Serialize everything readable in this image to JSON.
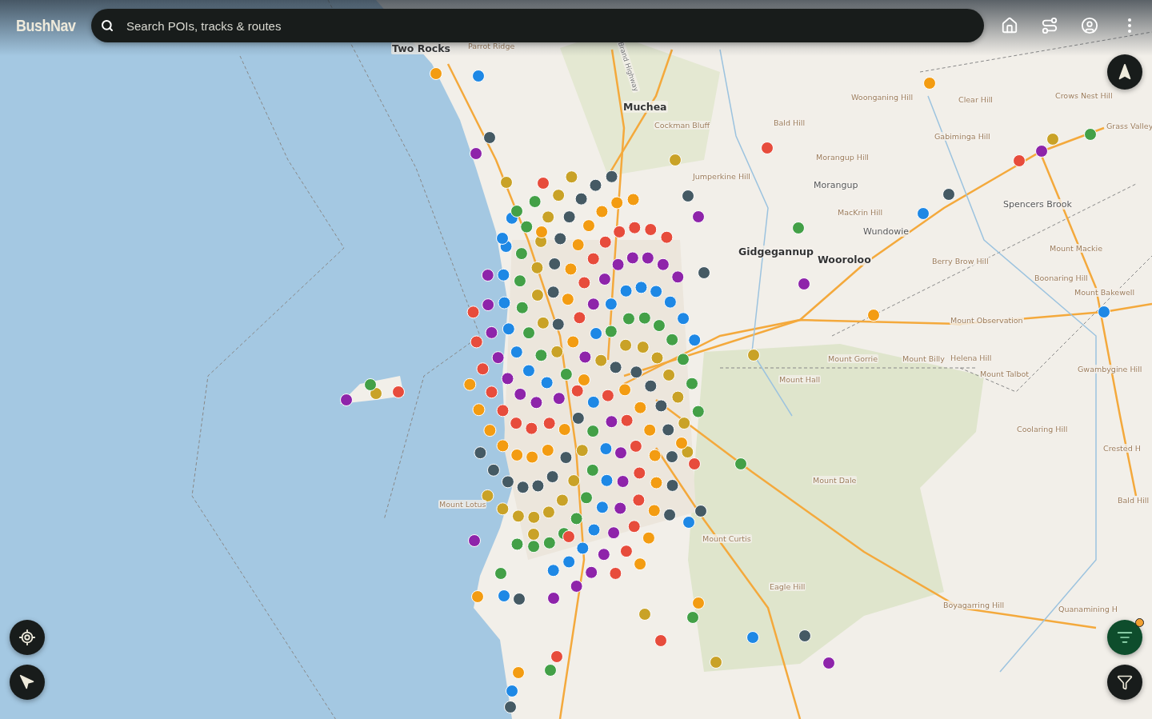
{
  "app": {
    "logo": "BushNav"
  },
  "search": {
    "placeholder": "Search POIs, tracks & routes"
  },
  "filter": {
    "active": true
  },
  "map_labels": [
    {
      "text": "Two Rocks",
      "kind": "town"
    },
    {
      "text": "Parrot Ridge",
      "kind": "locality"
    },
    {
      "text": "Brand Highway",
      "kind": "road"
    },
    {
      "text": "Muchea",
      "kind": "town"
    },
    {
      "text": "Cockman Bluff",
      "kind": "locality"
    },
    {
      "text": "Bald Hill",
      "kind": "locality"
    },
    {
      "text": "Woonganing Hill",
      "kind": "locality"
    },
    {
      "text": "Clear Hill",
      "kind": "locality"
    },
    {
      "text": "Crows Nest Hill",
      "kind": "locality"
    },
    {
      "text": "Grass Valley",
      "kind": "locality"
    },
    {
      "text": "Gabiminga Hill",
      "kind": "locality"
    },
    {
      "text": "Morangup Hill",
      "kind": "locality"
    },
    {
      "text": "Jumperkine Hill",
      "kind": "locality"
    },
    {
      "text": "Morangup",
      "kind": "place"
    },
    {
      "text": "MacKrin Hill",
      "kind": "locality"
    },
    {
      "text": "Wundowie",
      "kind": "place"
    },
    {
      "text": "Spencers Brook",
      "kind": "place"
    },
    {
      "text": "Gidgegannup",
      "kind": "town"
    },
    {
      "text": "Wooroloo",
      "kind": "town"
    },
    {
      "text": "Berry Brow Hill",
      "kind": "locality"
    },
    {
      "text": "Mount Mackie",
      "kind": "locality"
    },
    {
      "text": "Boonaring Hill",
      "kind": "locality"
    },
    {
      "text": "Mount Bakewell",
      "kind": "locality"
    },
    {
      "text": "Mount Observation",
      "kind": "locality"
    },
    {
      "text": "Mount Gorrie",
      "kind": "locality"
    },
    {
      "text": "Mount Billy",
      "kind": "locality"
    },
    {
      "text": "Helena Hill",
      "kind": "locality"
    },
    {
      "text": "Mount Talbot",
      "kind": "locality"
    },
    {
      "text": "Gwambygine Hill",
      "kind": "locality"
    },
    {
      "text": "Mount Hall",
      "kind": "locality"
    },
    {
      "text": "Coolaring Hill",
      "kind": "locality"
    },
    {
      "text": "Crested H",
      "kind": "locality"
    },
    {
      "text": "Mount Dale",
      "kind": "locality"
    },
    {
      "text": "Bald Hill",
      "kind": "locality"
    },
    {
      "text": "Mount Lotus",
      "kind": "locality"
    },
    {
      "text": "Mount Curtis",
      "kind": "locality"
    },
    {
      "text": "Eagle Hill",
      "kind": "locality"
    },
    {
      "text": "Boyagarring Hill",
      "kind": "locality"
    },
    {
      "text": "Quanamining H",
      "kind": "locality"
    }
  ]
}
